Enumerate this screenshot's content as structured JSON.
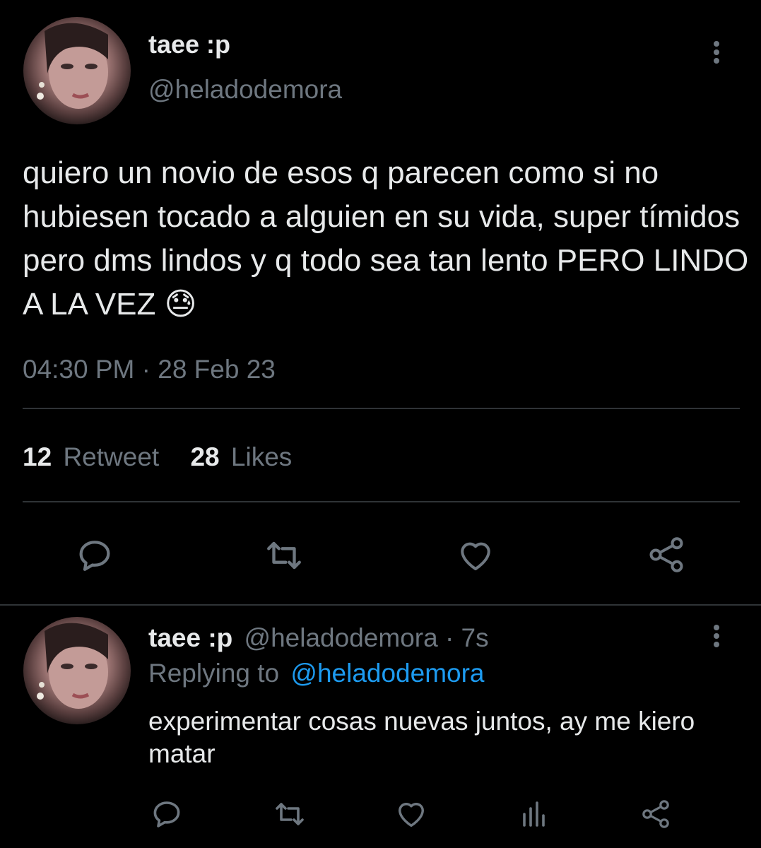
{
  "main_tweet": {
    "display_name": "taee :p",
    "handle": "@heladodemora",
    "text": "quiero un novio de esos q parecen como si no hubiesen tocado a alguien en su vida, super tímidos pero dms lindos y q todo sea tan lento PERO LINDO A LA VEZ",
    "emoji": "😓",
    "timestamp": "04:30 PM · 28 Feb 23",
    "retweet_count": "12",
    "retweet_label": "Retweet",
    "likes_count": "28",
    "likes_label": "Likes"
  },
  "reply_tweet": {
    "display_name": "taee :p",
    "handle_time": "@heladodemora · 7s",
    "replying_prefix": "Replying to",
    "replying_handle": "@heladodemora",
    "text": "experimentar cosas nuevas juntos, ay me kiero matar"
  },
  "icons": {
    "reply": "reply-icon",
    "retweet": "retweet-icon",
    "like": "heart-icon",
    "share": "share-icon",
    "analytics": "analytics-icon",
    "more": "more-icon"
  },
  "colors": {
    "background": "#000000",
    "text": "#e7e9ea",
    "muted": "#6e7780",
    "link": "#1d9bf0",
    "divider": "#2f3336"
  }
}
